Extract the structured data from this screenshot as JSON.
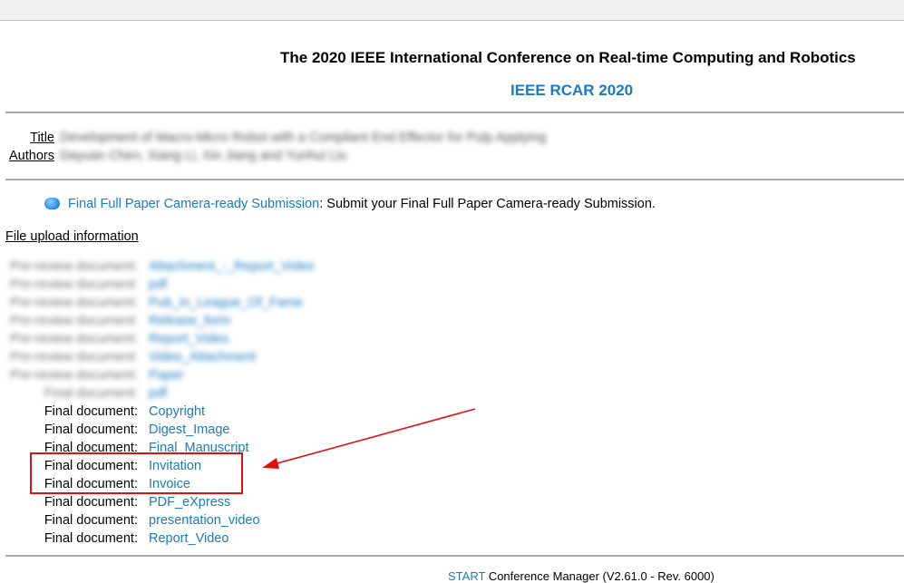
{
  "header": {
    "conference": "The 2020 IEEE International Conference on Real-time Computing and Robotics",
    "short_name": "IEEE RCAR 2020"
  },
  "paper": {
    "title_label": "Title",
    "authors_label": "Authors",
    "title_value": "Development of Macro-Micro Robot with a Compliant End Effector for Pulp Applying",
    "authors_value": "Dayuan Chen, Xiang Li, Xin Jiang and Yunhui Liu"
  },
  "submission": {
    "link": "Final Full Paper Camera-ready Submission",
    "text": ": Submit your Final Full Paper Camera-ready Submission."
  },
  "file_upload_label": "File upload information",
  "blurred_rows": [
    {
      "label": "Pre-review document:",
      "value": "Attachment_-_Report_Video"
    },
    {
      "label": "Pre-review document:",
      "value": "pdf"
    },
    {
      "label": "Pre-review document:",
      "value": "Pub_in_League_Of_Fame"
    },
    {
      "label": "Pre-review document:",
      "value": "Release_form"
    },
    {
      "label": "Pre-review document:",
      "value": "Report_Video"
    },
    {
      "label": "Pre-review document:",
      "value": "Video_Attachment"
    },
    {
      "label": "Pre-review document:",
      "value": "Paper"
    },
    {
      "label": "Final document:",
      "value": "pdf"
    }
  ],
  "rows": [
    {
      "label": "Final document:",
      "value": "Copyright"
    },
    {
      "label": "Final document:",
      "value": "Digest_Image"
    },
    {
      "label": "Final document:",
      "value": "Final_Manuscript"
    },
    {
      "label": "Final document:",
      "value": "Invitation"
    },
    {
      "label": "Final document:",
      "value": "Invoice"
    },
    {
      "label": "Final document:",
      "value": "PDF_eXpress"
    },
    {
      "label": "Final document:",
      "value": "presentation_video"
    },
    {
      "label": "Final document:",
      "value": "Report_Video"
    }
  ],
  "footer": {
    "link": "START",
    "text": " Conference Manager (V2.61.0 - Rev. 6000)"
  },
  "colors": {
    "link": "#1a7bbf",
    "annotation": "#e01010"
  }
}
